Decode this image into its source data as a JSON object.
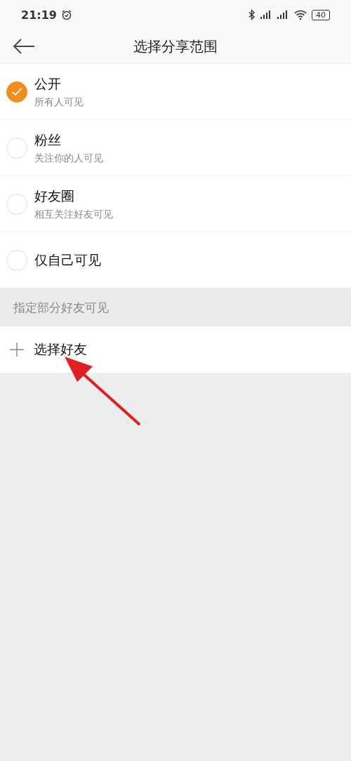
{
  "status_bar": {
    "time": "21:19",
    "battery": "40"
  },
  "header": {
    "title": "选择分享范围"
  },
  "options": [
    {
      "label": "公开",
      "description": "所有人可见",
      "selected": true
    },
    {
      "label": "粉丝",
      "description": "关注你的人可见",
      "selected": false
    },
    {
      "label": "好友圈",
      "description": "相互关注好友可见",
      "selected": false
    },
    {
      "label": "仅自己可见",
      "selected": false
    }
  ],
  "section": {
    "title": "指定部分好友可见"
  },
  "select_friends": {
    "label": "选择好友"
  }
}
